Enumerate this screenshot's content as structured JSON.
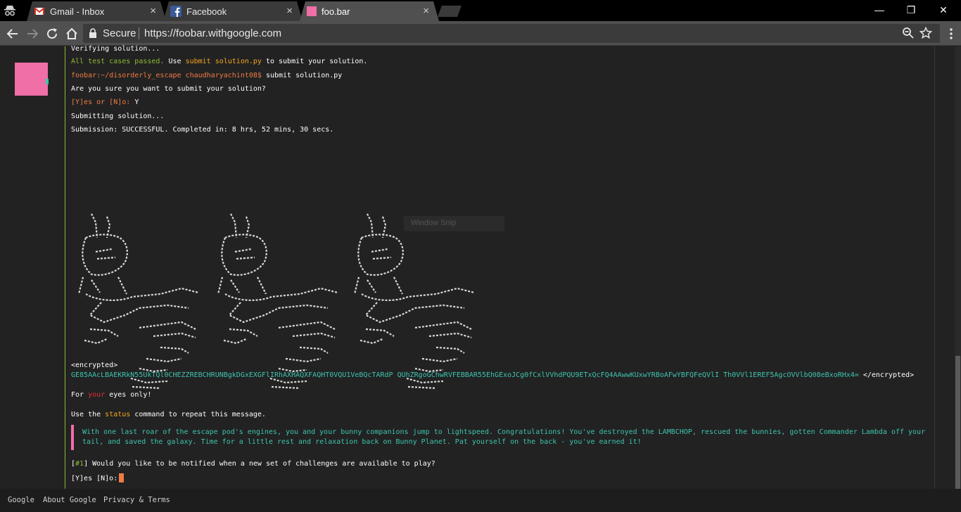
{
  "browser": {
    "tabs": [
      {
        "label": "Gmail - Inbox",
        "icon": "gmail-icon",
        "active": false
      },
      {
        "label": "Facebook",
        "icon": "facebook-icon",
        "active": false
      },
      {
        "label": "foo.bar",
        "icon": "foobar-icon",
        "active": true
      }
    ],
    "close_glyph": "×",
    "window_controls": {
      "minimize": "—",
      "maximize": "❐",
      "close": "✕"
    },
    "secure_label": "Secure",
    "url": "https://foobar.withgoogle.com",
    "colors": {
      "tabstrip": "#000000",
      "toolbar": "#505050",
      "accent_pink": "#f06fa7"
    }
  },
  "terminal": {
    "partial_line": "Verifying solution...",
    "passed_green": "All test cases passed.",
    "passed_use": " Use ",
    "passed_cmd": "submit solution.py",
    "passed_rest": " to submit your solution.",
    "prompt": "foobar:~/disorderly_escape chaudharyachint08$",
    "prompt_cmd": " submit solution.py",
    "confirm_q": "Are you sure you want to submit your solution?",
    "confirm_options": "[Y]es or [N]o:",
    "confirm_answer": " Y",
    "submitting": "Submitting solution...",
    "submission_result": "Submission: SUCCESSFUL. Completed in: 8 hrs, 52 mins, 30 secs.",
    "encrypted_open": "<encrypted>",
    "encrypted_body": "GE85AAcLBAEKRkN55UkTQl0CHEZZREBCHRUNBgkDGxEXGFlIRhAXHAQXFAQHT0VQU1VeBQcTARdP QUhZRgoGChwRVFEBBAR55EhGExoJCg0fCxlVVhdPQU9ETxQcFQ4AAwwKUxwYRBoAFwYBFQFeQVlI Th0VVl1EREF5AgcOVVlbQ08eBxoRHx4=",
    "encrypted_close": " </encrypted>",
    "eyes_for": "For ",
    "eyes_your": "your",
    "eyes_rest": " eyes only!",
    "status_use": "Use the ",
    "status_cmd": "status",
    "status_rest": " command to repeat this message.",
    "story": "With one last roar of the escape pod's engines, you and your bunny companions jump to lightspeed. Congratulations! You've destroyed the LAMBCHOP, rescued the bunnies, gotten Commander Lambda off your tail, and saved the galaxy. Time for a little rest and relaxation back on Bunny Planet. Pat yourself on the back - you've earned it!",
    "notify_open": "[",
    "notify_num": "#1",
    "notify_rest": "] Would you like to be notified when a new set of challenges are available to play?",
    "final_prompt": "[Y]es [N]o:",
    "overlay_text": "Window Snip",
    "colors": {
      "green": "#8dbb34",
      "orange": "#f5a623",
      "red": "#e62e3d",
      "cyan": "#3ec4ae",
      "prompt": "#ef7c44"
    }
  },
  "footer": {
    "links": [
      "Google",
      "About Google",
      "Privacy & Terms"
    ]
  }
}
